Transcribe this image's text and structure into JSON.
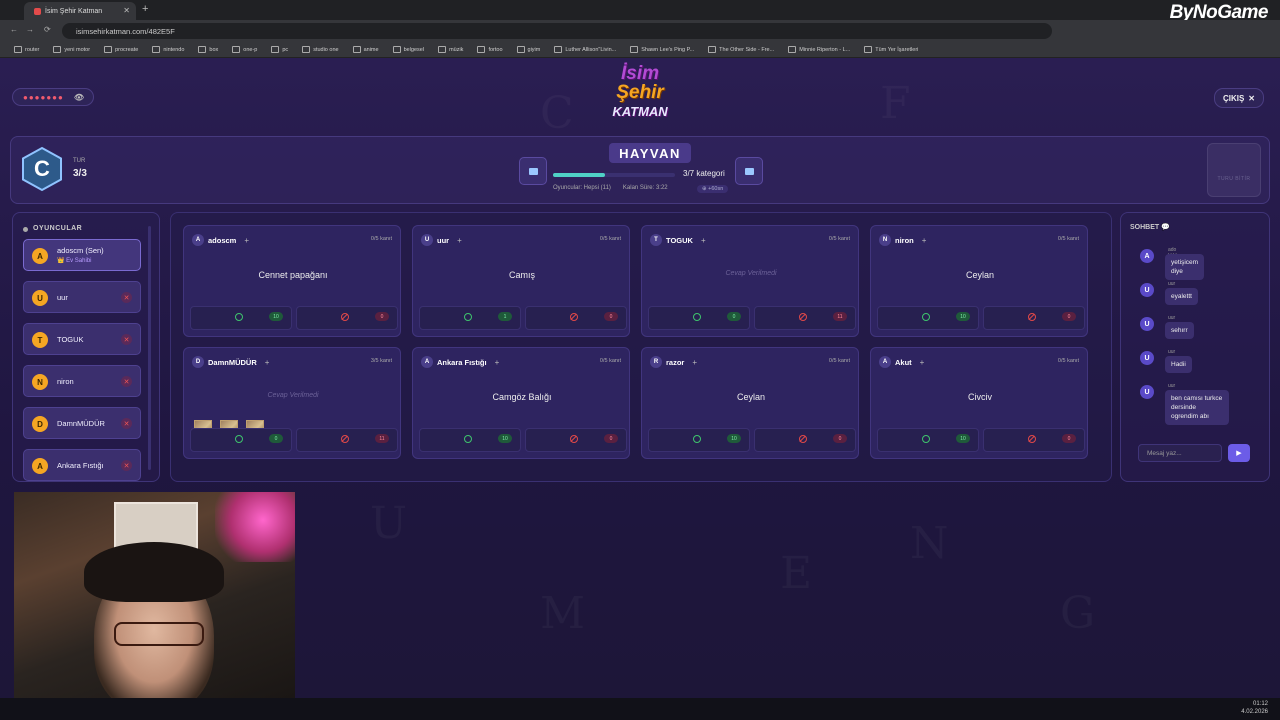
{
  "browser": {
    "tab_title": "İsim Şehir Katman",
    "url": "isimsehirkatman.com/482E5F",
    "brand": "ByNoGame",
    "bookmarks": [
      "router",
      "yeni motor",
      "procreate",
      "nintendo",
      "box",
      "one-p",
      "pc",
      "studio one",
      "anime",
      "belgesel",
      "müzik",
      "fortoo",
      "giyim",
      "Luther Allison\"Livin...",
      "Shawn Lee's Ping P...",
      "The Other Side - Fre...",
      "Minnie Riperton - L...",
      "Tüm Yer İşaretleri"
    ]
  },
  "header": {
    "room_code": "●●●●●●●",
    "logo_lines": [
      "İsim",
      "Şehir",
      "KATMAN"
    ],
    "exit_label": "ÇIKIŞ",
    "exit_icon": "close-icon"
  },
  "round": {
    "letter": "C",
    "tur_label": "TUR",
    "tur_value": "3/3",
    "category": "HAYVAN",
    "progress_fraction": 0.43,
    "category_count": "3/7 kategori",
    "players_info": "Oyuncular: Hepsi (11)",
    "time_left": "Kalan Süre: 3:22",
    "bonus": "⊕ +60sn",
    "finish_label": "TURU BİTİR"
  },
  "players": {
    "title": "OYUNCULAR",
    "items": [
      {
        "initial": "A",
        "name": "adoscm (Sen)",
        "sub": "👑 Ev Sahibi",
        "me": true
      },
      {
        "initial": "U",
        "name": "uur"
      },
      {
        "initial": "T",
        "name": "TOGUK"
      },
      {
        "initial": "N",
        "name": "niron"
      },
      {
        "initial": "D",
        "name": "DamnMÜDÜR"
      },
      {
        "initial": "A",
        "name": "Ankara Fıstığı"
      }
    ]
  },
  "answers": [
    {
      "initial": "A",
      "name": "adoscm",
      "votes": "0/5 kanıt",
      "answer": "Cennet papağanı",
      "ok": "10",
      "bad": "0"
    },
    {
      "initial": "U",
      "name": "uur",
      "votes": "0/5 kanıt",
      "answer": "Camış",
      "ok": "1",
      "bad": "0"
    },
    {
      "initial": "T",
      "name": "TOGUK",
      "votes": "0/5 kanıt",
      "answer": "Cevap Verilmedi",
      "none": true,
      "ok": "0",
      "bad": "11"
    },
    {
      "initial": "N",
      "name": "niron",
      "votes": "0/5 kanıt",
      "answer": "Ceylan",
      "ok": "10",
      "bad": "0"
    },
    {
      "initial": "D",
      "name": "DamnMÜDÜR",
      "votes": "3/5 kanıt",
      "answer": "Cevap Verilmedi",
      "none": true,
      "stickers": true,
      "ok": "0",
      "bad": "11"
    },
    {
      "initial": "A",
      "name": "Ankara Fıstığı",
      "votes": "0/5 kanıt",
      "answer": "Camgöz Balığı",
      "ok": "10",
      "bad": "0"
    },
    {
      "initial": "R",
      "name": "razor",
      "votes": "0/5 kanıt",
      "answer": "Ceylan",
      "ok": "10",
      "bad": "0"
    },
    {
      "initial": "A",
      "name": "Akut",
      "votes": "0/5 kanıt",
      "answer": "Civciv",
      "ok": "10",
      "bad": "0"
    }
  ],
  "chat": {
    "title": "SOHBET",
    "messages": [
      {
        "initial": "A",
        "author": "ado kkkk",
        "text": "yetişicem diye"
      },
      {
        "initial": "U",
        "author": "uur",
        "text": "eyalettt"
      },
      {
        "initial": "U",
        "author": "uur",
        "text": "sehırr"
      },
      {
        "initial": "U",
        "author": "uur",
        "text": "Hadii"
      },
      {
        "initial": "U",
        "author": "uur",
        "text": "ben camısı turkce dersinde ogrendim abı"
      }
    ],
    "input_placeholder": "Mesaj yaz...",
    "send_icon": "send-icon"
  },
  "taskbar": {
    "time": "01:12",
    "date": "4.02.2026"
  }
}
